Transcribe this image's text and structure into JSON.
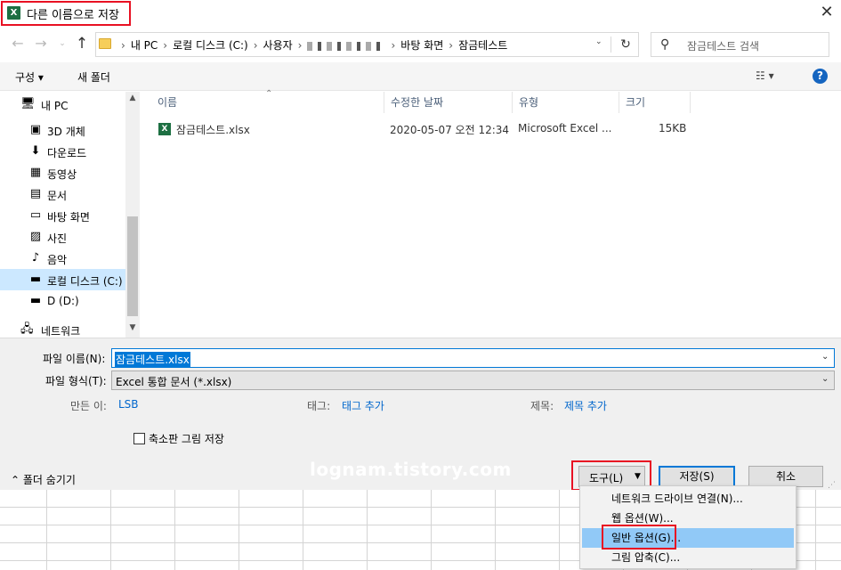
{
  "window": {
    "title": "다른 이름으로 저장",
    "excel_icon": "X",
    "close_glyph": "✕"
  },
  "nav": {
    "back": "←",
    "forward": "→",
    "recent": "⌄",
    "up": "↑"
  },
  "address": {
    "crumbs": [
      "내 PC",
      "로컬 디스크 (C:)",
      "사용자"
    ],
    "tail": [
      "바탕 화면",
      "잠금테스트"
    ],
    "separator": "›",
    "refresh_glyph": "↻",
    "dropdown_glyph": "⌄"
  },
  "search": {
    "placeholder": "잠금테스트 검색",
    "icon": "⚲"
  },
  "toolbar": {
    "organize_label": "구성 ▾",
    "new_folder_label": "새 폴더",
    "view_label": "☷ ▾",
    "help_glyph": "?"
  },
  "sidebar": {
    "items": [
      {
        "label": "내 PC",
        "icon": "🖥",
        "icon_name": "computer-icon",
        "top": true
      },
      {
        "label": "3D 개체",
        "icon": "▣",
        "icon_name": "cube-icon"
      },
      {
        "label": "다운로드",
        "icon": "⬇",
        "icon_name": "download-icon"
      },
      {
        "label": "동영상",
        "icon": "▦",
        "icon_name": "film-icon"
      },
      {
        "label": "문서",
        "icon": "▤",
        "icon_name": "document-icon"
      },
      {
        "label": "바탕 화면",
        "icon": "▭",
        "icon_name": "desktop-icon"
      },
      {
        "label": "사진",
        "icon": "▨",
        "icon_name": "picture-icon"
      },
      {
        "label": "음악",
        "icon": "♪",
        "icon_name": "music-icon"
      },
      {
        "label": "로컬 디스크 (C:)",
        "icon": "▬",
        "icon_name": "drive-icon",
        "selected": true
      },
      {
        "label": "D (D:)",
        "icon": "▬",
        "icon_name": "drive-icon"
      },
      {
        "label": "네트워크",
        "icon": "🖧",
        "icon_name": "network-icon",
        "top": true
      }
    ]
  },
  "file_list": {
    "columns": [
      "이름",
      "수정한 날짜",
      "유형",
      "크기"
    ],
    "rows": [
      {
        "name": "잠금테스트.xlsx",
        "modified": "2020-05-07 오전 12:34",
        "type": "Microsoft Excel ...",
        "size": "15KB"
      }
    ]
  },
  "form": {
    "filename_label": "파일 이름(N):",
    "filename_value": "잠금테스트.xlsx",
    "filetype_label": "파일 형식(T):",
    "filetype_value": "Excel 통합 문서 (*.xlsx)",
    "author_label": "만든 이:",
    "author_value": "LSB",
    "tags_label": "태그:",
    "tags_value": "태그 추가",
    "title_label": "제목:",
    "title_value": "제목 추가",
    "thumbnail_label": "축소판 그림 저장",
    "hide_folders_label": "폴더 숨기기"
  },
  "buttons": {
    "tools_label": "도구(L)",
    "save_label": "저장(S)",
    "cancel_label": "취소"
  },
  "tools_menu": {
    "items": [
      {
        "label": "네트워크 드라이브 연결(N)..."
      },
      {
        "label": "웹 옵션(W)..."
      },
      {
        "label": "일반 옵션(G)...",
        "hovered": true
      },
      {
        "label": "그림 압축(C)..."
      }
    ]
  },
  "watermark": "lognam.tistory.com",
  "colors": {
    "highlight_red": "#e81123",
    "accent_blue": "#0078d7",
    "excel_green": "#1d6f42"
  }
}
